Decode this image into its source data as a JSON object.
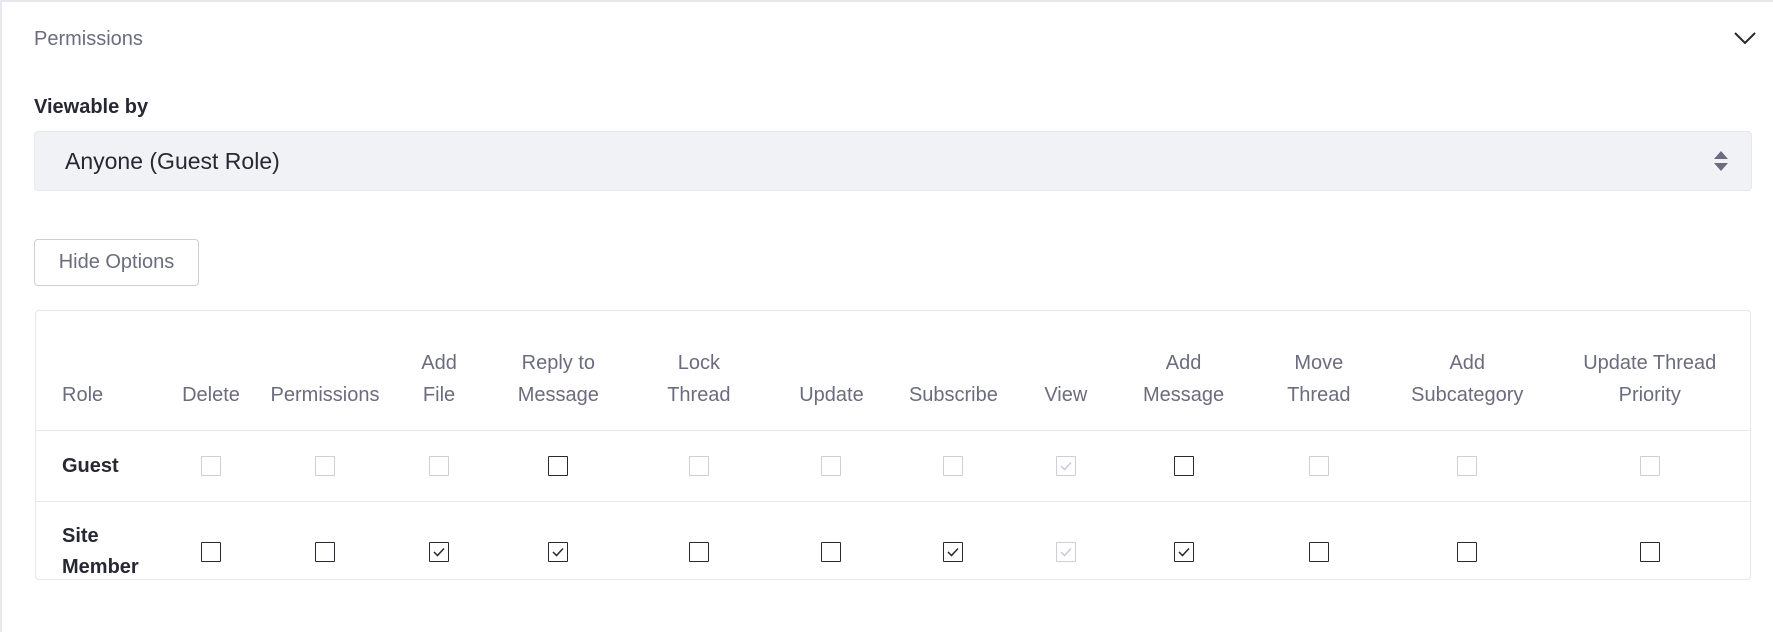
{
  "panel": {
    "title": "Permissions"
  },
  "viewable_by": {
    "label": "Viewable by",
    "selected": "Anyone (Guest Role)"
  },
  "options_button": {
    "label": "Hide Options"
  },
  "permissions_table": {
    "columns": [
      [
        "Role"
      ],
      [
        "Delete"
      ],
      [
        "Permissions"
      ],
      [
        "Add",
        "File"
      ],
      [
        "Reply to",
        "Message"
      ],
      [
        "Lock",
        "Thread"
      ],
      [
        "Update"
      ],
      [
        "Subscribe"
      ],
      [
        "View"
      ],
      [
        "Add",
        "Message"
      ],
      [
        "Move",
        "Thread"
      ],
      [
        "Add",
        "Subcategory"
      ],
      [
        "Update Thread",
        "Priority"
      ]
    ],
    "rows": [
      {
        "role": [
          "Guest"
        ],
        "cells": [
          {
            "checked": false,
            "disabled": true
          },
          {
            "checked": false,
            "disabled": true
          },
          {
            "checked": false,
            "disabled": true
          },
          {
            "checked": false,
            "disabled": false
          },
          {
            "checked": false,
            "disabled": true
          },
          {
            "checked": false,
            "disabled": true
          },
          {
            "checked": false,
            "disabled": true
          },
          {
            "checked": true,
            "disabled": true
          },
          {
            "checked": false,
            "disabled": false
          },
          {
            "checked": false,
            "disabled": true
          },
          {
            "checked": false,
            "disabled": true
          },
          {
            "checked": false,
            "disabled": true
          }
        ]
      },
      {
        "role": [
          "Site",
          "Member"
        ],
        "cells": [
          {
            "checked": false,
            "disabled": false
          },
          {
            "checked": false,
            "disabled": false
          },
          {
            "checked": true,
            "disabled": false
          },
          {
            "checked": true,
            "disabled": false
          },
          {
            "checked": false,
            "disabled": false
          },
          {
            "checked": false,
            "disabled": false
          },
          {
            "checked": true,
            "disabled": false
          },
          {
            "checked": true,
            "disabled": true
          },
          {
            "checked": true,
            "disabled": false
          },
          {
            "checked": false,
            "disabled": false
          },
          {
            "checked": false,
            "disabled": false
          },
          {
            "checked": false,
            "disabled": false
          }
        ]
      }
    ]
  },
  "icons": {
    "collapse": "chevron-down-icon",
    "select_arrows": "sort-arrows-icon",
    "check": "check-icon"
  },
  "colors": {
    "text": "#272833",
    "muted_text": "#6b6c7e",
    "border": "#e7e7ed",
    "select_bg": "#f1f2f5",
    "disabled_border": "#cdced9"
  }
}
